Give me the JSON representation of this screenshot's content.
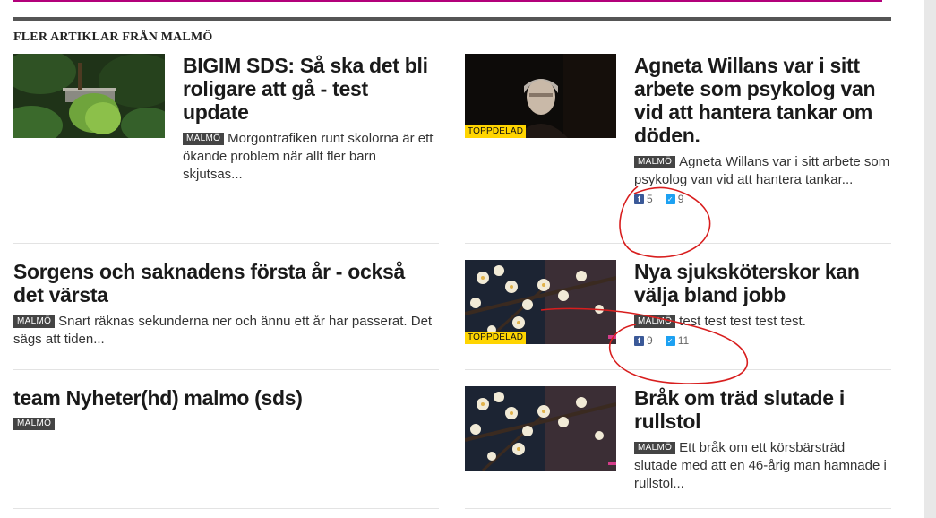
{
  "section": {
    "title": "FLER ARTIKLAR FRÅN MALMÖ"
  },
  "articles": [
    {
      "headline": "BIGIM SDS: Så ska det bli roligare att gå - test update",
      "tag": "MALMÖ",
      "teaser": "Morgontrafiken runt skolorna är ett ökande problem när allt fler barn skjutsas...",
      "image": "garden-plants"
    },
    {
      "headline": "Agneta Willans var i sitt arbete som psykolog van vid att hantera tankar om döden.",
      "tag": "MALMÖ",
      "teaser": "Agneta Willans var i sitt arbete som psykolog van vid att hantera tankar...",
      "badge": "TOPPDELAD",
      "facebook": "5",
      "twitter": "9",
      "image": "portrait-woman"
    },
    {
      "headline": "Sorgens och saknadens första år - också det värsta",
      "tag": "MALMÖ",
      "teaser": "Snart räknas sekunderna ner och ännu ett år har passerat. Det sägs att tiden..."
    },
    {
      "headline": "Nya sjuksköterskor kan välja bland jobb",
      "tag": "MALMÖ",
      "teaser": "test test test test test.",
      "badge": "TOPPDELAD",
      "facebook": "9",
      "twitter": "11",
      "image": "blossoms"
    },
    {
      "headline": "team Nyheter(hd) malmo (sds)",
      "tag": "MALMÖ",
      "teaser": ""
    },
    {
      "headline": "Bråk om träd slutade i rullstol",
      "tag": "MALMÖ",
      "teaser": "Ett bråk om ett körsbärsträd slutade med att en 46-årig man hamnade i rullstol...",
      "image": "blossoms"
    }
  ],
  "icons": {
    "facebook": "facebook-icon",
    "twitter": "twitter-icon"
  },
  "colors": {
    "accent_line": "#b3007a",
    "badge": "#ffd500",
    "tag": "#444444",
    "annotation": "#d81e1e"
  }
}
